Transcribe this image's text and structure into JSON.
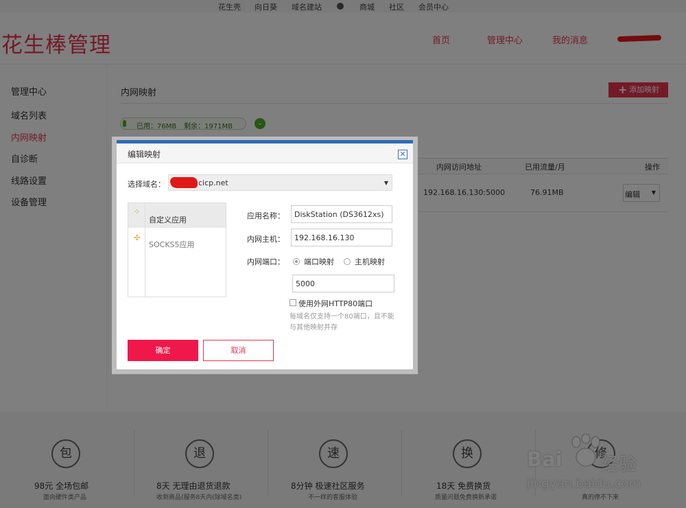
{
  "top_links": [
    "花生壳",
    "向日葵",
    "域名建站",
    "商城",
    "社区",
    "会员中心"
  ],
  "header": {
    "logo": "花生棒管理",
    "nav": [
      "首页",
      "管理中心",
      "我的消息"
    ]
  },
  "sidebar": {
    "items": [
      {
        "label": "管理中心",
        "active": false
      },
      {
        "label": "域名列表",
        "active": false
      },
      {
        "label": "内网映射",
        "active": true
      },
      {
        "label": "自诊断",
        "active": false
      },
      {
        "label": "线路设置",
        "active": false
      },
      {
        "label": "设备管理",
        "active": false
      }
    ]
  },
  "main": {
    "title": "内网映射",
    "add_button": "添加映射",
    "usage": {
      "used": "已用：76MB",
      "remaining": "剩余：1971MB",
      "used_fraction": 0.037
    },
    "table": {
      "headers": [
        "内网访问地址",
        "已用流量/月",
        "操作"
      ],
      "rows": [
        {
          "address": "192.168.16.130:5000",
          "traffic": "76.91MB",
          "action": "编辑"
        }
      ]
    }
  },
  "dialog": {
    "title": "编辑映射",
    "close_icon": "close-icon",
    "domain_label": "选择域名：",
    "domain_value": "cicp.net",
    "apps": [
      {
        "label": "自定义应用",
        "selected": true,
        "icon": "custom-app-icon"
      },
      {
        "label": "SOCKS5应用",
        "selected": false,
        "icon": "socks5-icon"
      }
    ],
    "fields": {
      "app_name_label": "应用名称：",
      "app_name_value": "DiskStation (DS3612xs)",
      "host_label": "内网主机：",
      "host_value": "192.168.16.130",
      "port_label": "内网端口：",
      "port_mode_options": [
        "端口映射",
        "主机映射"
      ],
      "port_mode_selected": "端口映射",
      "port_value": "5000"
    },
    "http80_checkbox_label": "使用外网HTTP80端口",
    "http80_checked": false,
    "hint": "每域名仅支持一个80端口，且不能与其他映射并存",
    "ok_button": "确定",
    "cancel_button": "取消"
  },
  "footer": [
    {
      "icon_char": "包",
      "title": "98元 全场包邮",
      "sub": "面向硬件类产品"
    },
    {
      "icon_char": "退",
      "title": "8天 无理由退货退款",
      "sub": "收到商品(服务8天内(除域名类)"
    },
    {
      "icon_char": "速",
      "title": "8分钟 极速社区服务",
      "sub": "不一样的客服体验"
    },
    {
      "icon_char": "换",
      "title": "18天 免费换货",
      "sub": "质量问题免费换新承诺"
    },
    {
      "icon_char": "修",
      "title": "",
      "sub": "真的停不下来"
    }
  ],
  "watermark": {
    "brand": "Bai",
    "brand_cn": "经验",
    "url": "jingyan.baidu.com"
  },
  "colors": {
    "accent": "#e8344e",
    "dialog_top": "#2f6bb8",
    "ok_button": "#f0184a",
    "usage_green": "#4caf20"
  }
}
